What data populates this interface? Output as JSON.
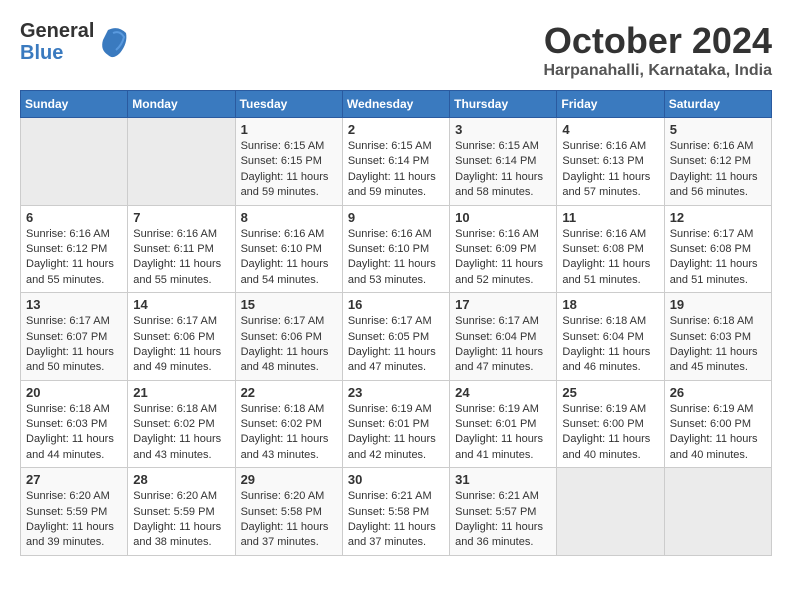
{
  "header": {
    "logo_line1": "General",
    "logo_line2": "Blue",
    "month": "October 2024",
    "location": "Harpanahalli, Karnataka, India"
  },
  "weekdays": [
    "Sunday",
    "Monday",
    "Tuesday",
    "Wednesday",
    "Thursday",
    "Friday",
    "Saturday"
  ],
  "weeks": [
    [
      {
        "day": "",
        "info": ""
      },
      {
        "day": "",
        "info": ""
      },
      {
        "day": "1",
        "info": "Sunrise: 6:15 AM\nSunset: 6:15 PM\nDaylight: 11 hours and 59 minutes."
      },
      {
        "day": "2",
        "info": "Sunrise: 6:15 AM\nSunset: 6:14 PM\nDaylight: 11 hours and 59 minutes."
      },
      {
        "day": "3",
        "info": "Sunrise: 6:15 AM\nSunset: 6:14 PM\nDaylight: 11 hours and 58 minutes."
      },
      {
        "day": "4",
        "info": "Sunrise: 6:16 AM\nSunset: 6:13 PM\nDaylight: 11 hours and 57 minutes."
      },
      {
        "day": "5",
        "info": "Sunrise: 6:16 AM\nSunset: 6:12 PM\nDaylight: 11 hours and 56 minutes."
      }
    ],
    [
      {
        "day": "6",
        "info": "Sunrise: 6:16 AM\nSunset: 6:12 PM\nDaylight: 11 hours and 55 minutes."
      },
      {
        "day": "7",
        "info": "Sunrise: 6:16 AM\nSunset: 6:11 PM\nDaylight: 11 hours and 55 minutes."
      },
      {
        "day": "8",
        "info": "Sunrise: 6:16 AM\nSunset: 6:10 PM\nDaylight: 11 hours and 54 minutes."
      },
      {
        "day": "9",
        "info": "Sunrise: 6:16 AM\nSunset: 6:10 PM\nDaylight: 11 hours and 53 minutes."
      },
      {
        "day": "10",
        "info": "Sunrise: 6:16 AM\nSunset: 6:09 PM\nDaylight: 11 hours and 52 minutes."
      },
      {
        "day": "11",
        "info": "Sunrise: 6:16 AM\nSunset: 6:08 PM\nDaylight: 11 hours and 51 minutes."
      },
      {
        "day": "12",
        "info": "Sunrise: 6:17 AM\nSunset: 6:08 PM\nDaylight: 11 hours and 51 minutes."
      }
    ],
    [
      {
        "day": "13",
        "info": "Sunrise: 6:17 AM\nSunset: 6:07 PM\nDaylight: 11 hours and 50 minutes."
      },
      {
        "day": "14",
        "info": "Sunrise: 6:17 AM\nSunset: 6:06 PM\nDaylight: 11 hours and 49 minutes."
      },
      {
        "day": "15",
        "info": "Sunrise: 6:17 AM\nSunset: 6:06 PM\nDaylight: 11 hours and 48 minutes."
      },
      {
        "day": "16",
        "info": "Sunrise: 6:17 AM\nSunset: 6:05 PM\nDaylight: 11 hours and 47 minutes."
      },
      {
        "day": "17",
        "info": "Sunrise: 6:17 AM\nSunset: 6:04 PM\nDaylight: 11 hours and 47 minutes."
      },
      {
        "day": "18",
        "info": "Sunrise: 6:18 AM\nSunset: 6:04 PM\nDaylight: 11 hours and 46 minutes."
      },
      {
        "day": "19",
        "info": "Sunrise: 6:18 AM\nSunset: 6:03 PM\nDaylight: 11 hours and 45 minutes."
      }
    ],
    [
      {
        "day": "20",
        "info": "Sunrise: 6:18 AM\nSunset: 6:03 PM\nDaylight: 11 hours and 44 minutes."
      },
      {
        "day": "21",
        "info": "Sunrise: 6:18 AM\nSunset: 6:02 PM\nDaylight: 11 hours and 43 minutes."
      },
      {
        "day": "22",
        "info": "Sunrise: 6:18 AM\nSunset: 6:02 PM\nDaylight: 11 hours and 43 minutes."
      },
      {
        "day": "23",
        "info": "Sunrise: 6:19 AM\nSunset: 6:01 PM\nDaylight: 11 hours and 42 minutes."
      },
      {
        "day": "24",
        "info": "Sunrise: 6:19 AM\nSunset: 6:01 PM\nDaylight: 11 hours and 41 minutes."
      },
      {
        "day": "25",
        "info": "Sunrise: 6:19 AM\nSunset: 6:00 PM\nDaylight: 11 hours and 40 minutes."
      },
      {
        "day": "26",
        "info": "Sunrise: 6:19 AM\nSunset: 6:00 PM\nDaylight: 11 hours and 40 minutes."
      }
    ],
    [
      {
        "day": "27",
        "info": "Sunrise: 6:20 AM\nSunset: 5:59 PM\nDaylight: 11 hours and 39 minutes."
      },
      {
        "day": "28",
        "info": "Sunrise: 6:20 AM\nSunset: 5:59 PM\nDaylight: 11 hours and 38 minutes."
      },
      {
        "day": "29",
        "info": "Sunrise: 6:20 AM\nSunset: 5:58 PM\nDaylight: 11 hours and 37 minutes."
      },
      {
        "day": "30",
        "info": "Sunrise: 6:21 AM\nSunset: 5:58 PM\nDaylight: 11 hours and 37 minutes."
      },
      {
        "day": "31",
        "info": "Sunrise: 6:21 AM\nSunset: 5:57 PM\nDaylight: 11 hours and 36 minutes."
      },
      {
        "day": "",
        "info": ""
      },
      {
        "day": "",
        "info": ""
      }
    ]
  ]
}
